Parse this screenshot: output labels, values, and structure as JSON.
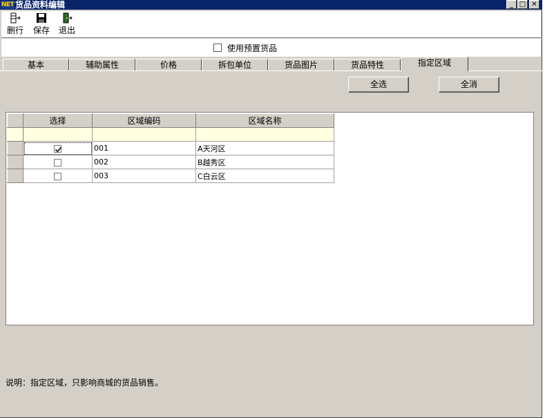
{
  "window": {
    "logo": "NET",
    "title": "货品资料编辑",
    "controls": {
      "minimize": "_",
      "maximize": "□",
      "close": "✕"
    }
  },
  "toolbar": {
    "delete_row": "删行",
    "save": "保存",
    "exit": "退出"
  },
  "preset": {
    "label": "使用预置货品",
    "checked": false
  },
  "tabs": [
    {
      "label": "基本",
      "active": false
    },
    {
      "label": "辅助属性",
      "active": false
    },
    {
      "label": "价格",
      "active": false
    },
    {
      "label": "拆包单位",
      "active": false
    },
    {
      "label": "货品图片",
      "active": false
    },
    {
      "label": "货品特性",
      "active": false
    },
    {
      "label": "指定区域",
      "active": true
    }
  ],
  "actions": {
    "select_all": "全选",
    "deselect_all": "全消"
  },
  "grid": {
    "headers": [
      "选择",
      "区域编码",
      "区域名称"
    ],
    "rows": [
      {
        "checked": true,
        "code": "001",
        "name": "A天河区"
      },
      {
        "checked": false,
        "code": "002",
        "name": "B越秀区"
      },
      {
        "checked": false,
        "code": "003",
        "name": "C白云区"
      }
    ]
  },
  "note": "说明：指定区域，只影响商城的货品销售。"
}
